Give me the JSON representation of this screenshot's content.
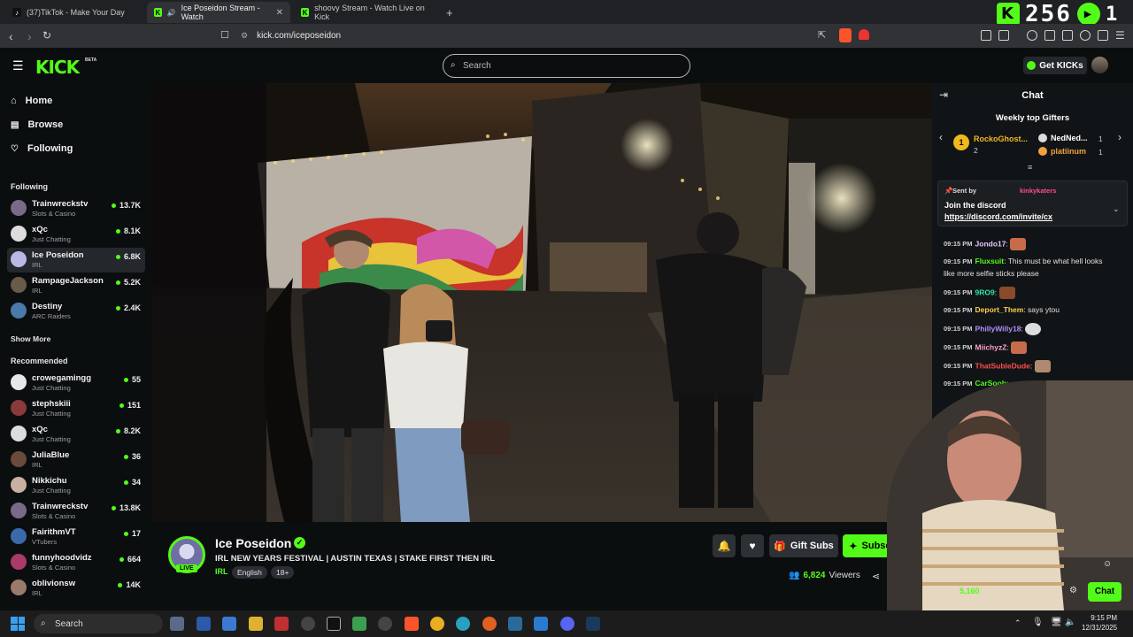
{
  "browser": {
    "tabs": [
      {
        "label": "(37)TikTok - Make Your Day",
        "active": false
      },
      {
        "label": "Ice Poseidon Stream - Watch",
        "active": true
      },
      {
        "label": "shoovy Stream - Watch Live on Kick",
        "active": false
      }
    ],
    "new_tab": "+",
    "url": "kick.com/iceposeidon",
    "overlay_counter": "256",
    "overlay_suffix": "1"
  },
  "header": {
    "logo": "KICK",
    "logo_badge": "BETA",
    "search_placeholder": "Search",
    "get_kicks": "Get KICKs"
  },
  "sidebar": {
    "nav": [
      {
        "label": "Home",
        "icon": "home-icon"
      },
      {
        "label": "Browse",
        "icon": "browse-icon"
      },
      {
        "label": "Following",
        "icon": "heart-icon"
      }
    ],
    "following_header": "Following",
    "following": [
      {
        "name": "Trainwreckstv",
        "category": "Slots & Casino",
        "viewers": "13.7K"
      },
      {
        "name": "xQc",
        "category": "Just Chatting",
        "viewers": "8.1K"
      },
      {
        "name": "Ice Poseidon",
        "category": "IRL",
        "viewers": "6.8K"
      },
      {
        "name": "RampageJackson",
        "category": "IRL",
        "viewers": "5.2K"
      },
      {
        "name": "Destiny",
        "category": "ARC Raiders",
        "viewers": "2.4K"
      }
    ],
    "show_more": "Show More",
    "recommended_header": "Recommended",
    "recommended": [
      {
        "name": "crowegamingg",
        "category": "Just Chatting",
        "viewers": "55"
      },
      {
        "name": "stephskiii",
        "category": "Just Chatting",
        "viewers": "151"
      },
      {
        "name": "xQc",
        "category": "Just Chatting",
        "viewers": "8.2K"
      },
      {
        "name": "JuliaBlue",
        "category": "IRL",
        "viewers": "36"
      },
      {
        "name": "Nikkichu",
        "category": "Just Chatting",
        "viewers": "34"
      },
      {
        "name": "Trainwreckstv",
        "category": "Slots & Casino",
        "viewers": "13.8K"
      },
      {
        "name": "FairithmVT",
        "category": "VTubers",
        "viewers": "17"
      },
      {
        "name": "funnyhoodvidz",
        "category": "Slots & Casino",
        "viewers": "664"
      },
      {
        "name": "oblivionsw",
        "category": "IRL",
        "viewers": "14K"
      }
    ]
  },
  "stream": {
    "name": "Ice Poseidon",
    "live": "LIVE",
    "title": "IRL NEW YEARS FESTIVAL | AUSTIN TEXAS | STAKE FIRST THEN IRL",
    "category": "IRL",
    "tags": [
      "English",
      "18+"
    ],
    "gift_subs": "Gift Subs",
    "subscribe": "Subscribe",
    "viewer_count": "6,824",
    "viewers_label": "Viewers"
  },
  "chat": {
    "title": "Chat",
    "gifters_title": "Weekly top Gifters",
    "gifters": [
      {
        "rank": "1",
        "name": "RockoGhost...",
        "count": "2"
      },
      {
        "name": "NedNed...",
        "count": "1"
      },
      {
        "name": "platiinum",
        "count": "1"
      }
    ],
    "pinned": {
      "sent_by": "Sent by",
      "sender": "kinkykaters",
      "line1": "Join the discord",
      "line2": "https://discord.com/invite/cx"
    },
    "messages": [
      {
        "time": "09:15 PM",
        "user": "Jondo17",
        "text": ":",
        "color": "#e9c8ff"
      },
      {
        "time": "09:15 PM",
        "user": "Fluxsuit",
        "text": ": This must be what hell looks",
        "color": "#53fc18"
      },
      {
        "time": "",
        "user": "",
        "text": "like       more selfie sticks please",
        "color": "#e0e0e0"
      },
      {
        "time": "09:15 PM",
        "user": "9RO9",
        "text": ":",
        "color": "#2ee6a6"
      },
      {
        "time": "09:15 PM",
        "user": "Deport_Them",
        "text": ": says ytou",
        "color": "#ffd04a"
      },
      {
        "time": "09:15 PM",
        "user": "PhillyWilly18",
        "text": ":",
        "color": "#b48cff"
      },
      {
        "time": "09:15 PM",
        "user": "MiichyzZ",
        "text": ":",
        "color": "#ffa0c8"
      },
      {
        "time": "09:15 PM",
        "user": "ThatSubleDude",
        "text": ":",
        "color": "#ff4d4d"
      },
      {
        "time": "09:15 PM",
        "user": "CarSoob",
        "text": ":",
        "color": "#53fc18"
      }
    ],
    "chat_button": "Chat",
    "webcam_counter": "5,160"
  },
  "taskbar": {
    "search": "Search",
    "time": "9:15 PM",
    "date": "12/31/2025"
  },
  "colors": {
    "accent": "#53fc18",
    "background": "#0b0e0f",
    "panel": "#111416"
  }
}
